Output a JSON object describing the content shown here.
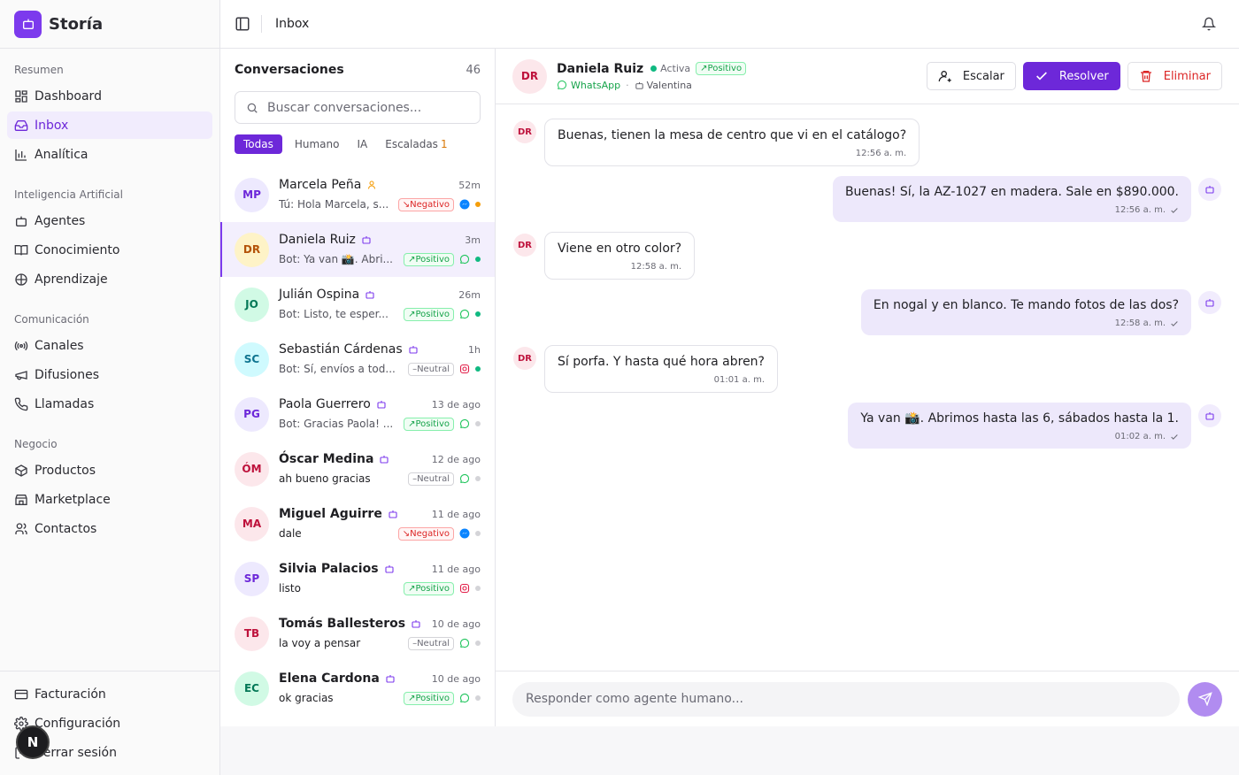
{
  "brand": {
    "name": "Storía"
  },
  "topbar": {
    "title": "Inbox"
  },
  "sidebar": {
    "sections": [
      {
        "title": "Resumen",
        "items": [
          {
            "label": "Dashboard",
            "icon": "home-icon",
            "active": false
          },
          {
            "label": "Inbox",
            "icon": "inbox-icon",
            "active": true
          },
          {
            "label": "Analítica",
            "icon": "chart-icon",
            "active": false
          }
        ]
      },
      {
        "title": "Inteligencia Artificial",
        "items": [
          {
            "label": "Agentes",
            "icon": "bot-icon",
            "active": false
          },
          {
            "label": "Conocimiento",
            "icon": "book-icon",
            "active": false
          },
          {
            "label": "Aprendizaje",
            "icon": "brain-icon",
            "active": false
          }
        ]
      },
      {
        "title": "Comunicación",
        "items": [
          {
            "label": "Canales",
            "icon": "radio-icon",
            "active": false
          },
          {
            "label": "Difusiones",
            "icon": "megaphone-icon",
            "active": false
          },
          {
            "label": "Llamadas",
            "icon": "phone-icon",
            "active": false
          }
        ]
      },
      {
        "title": "Negocio",
        "items": [
          {
            "label": "Productos",
            "icon": "package-icon",
            "active": false
          },
          {
            "label": "Marketplace",
            "icon": "store-icon",
            "active": false
          },
          {
            "label": "Contactos",
            "icon": "users-icon",
            "active": false
          }
        ]
      }
    ],
    "bottom": [
      {
        "label": "Facturación",
        "icon": "card-icon"
      },
      {
        "label": "Configuración",
        "icon": "gear-icon"
      },
      {
        "label": "Cerrar sesión",
        "icon": "logout-icon"
      }
    ],
    "floating_badge": "N"
  },
  "conversations": {
    "title": "Conversaciones",
    "count": "46",
    "search_placeholder": "Buscar conversaciones...",
    "filters": [
      {
        "label": "Todas",
        "active": true,
        "count": ""
      },
      {
        "label": "Humano",
        "active": false,
        "count": ""
      },
      {
        "label": "IA",
        "active": false,
        "count": ""
      },
      {
        "label": "Escaladas",
        "active": false,
        "count": "1"
      }
    ],
    "items": [
      {
        "initials": "MP",
        "name": "Marcela Peña",
        "handler": "human",
        "time": "52m",
        "preview": "Tú: Hola Marcela, s...",
        "sentiment": "Negativo",
        "channel": "messenger",
        "dot": "#f59e0b",
        "avatar_bg": "#ede9fe",
        "avatar_fg": "#6d28d9",
        "bold": false,
        "active": false,
        "dark_preview": false
      },
      {
        "initials": "DR",
        "name": "Daniela Ruiz",
        "handler": "bot",
        "time": "3m",
        "preview": "Bot: Ya van 📸. Abri...",
        "sentiment": "Positivo",
        "channel": "whatsapp",
        "dot": "#10b981",
        "avatar_bg": "#fef3c7",
        "avatar_fg": "#b45309",
        "bold": false,
        "active": true,
        "dark_preview": false
      },
      {
        "initials": "JO",
        "name": "Julián Ospina",
        "handler": "bot",
        "time": "26m",
        "preview": "Bot: Listo, te esper...",
        "sentiment": "Positivo",
        "channel": "whatsapp",
        "dot": "#10b981",
        "avatar_bg": "#d1fae5",
        "avatar_fg": "#047857",
        "bold": false,
        "active": false,
        "dark_preview": false
      },
      {
        "initials": "SC",
        "name": "Sebastián Cárdenas",
        "handler": "bot",
        "time": "1h",
        "preview": "Bot: Sí, envíos a tod...",
        "sentiment": "Neutral",
        "channel": "instagram",
        "dot": "#10b981",
        "avatar_bg": "#cffafe",
        "avatar_fg": "#0e7490",
        "bold": false,
        "active": false,
        "dark_preview": false
      },
      {
        "initials": "PG",
        "name": "Paola Guerrero",
        "handler": "bot",
        "time": "13 de ago",
        "preview": "Bot: Gracias Paola! ...",
        "sentiment": "Positivo",
        "channel": "whatsapp",
        "dot": "#d4d4d8",
        "avatar_bg": "#ede9fe",
        "avatar_fg": "#6d28d9",
        "bold": false,
        "active": false,
        "dark_preview": false
      },
      {
        "initials": "ÓM",
        "name": "Óscar Medina",
        "handler": "bot",
        "time": "12 de ago",
        "preview": "ah bueno gracias",
        "sentiment": "Neutral",
        "channel": "whatsapp",
        "dot": "#d4d4d8",
        "avatar_bg": "#fce7eb",
        "avatar_fg": "#be123c",
        "bold": true,
        "active": false,
        "dark_preview": true
      },
      {
        "initials": "MA",
        "name": "Miguel Aguirre",
        "handler": "bot",
        "time": "11 de ago",
        "preview": "dale",
        "sentiment": "Negativo",
        "channel": "messenger",
        "dot": "#d4d4d8",
        "avatar_bg": "#fce7eb",
        "avatar_fg": "#be123c",
        "bold": true,
        "active": false,
        "dark_preview": true
      },
      {
        "initials": "SP",
        "name": "Silvia Palacios",
        "handler": "bot",
        "time": "11 de ago",
        "preview": "listo",
        "sentiment": "Positivo",
        "channel": "instagram",
        "dot": "#d4d4d8",
        "avatar_bg": "#ede9fe",
        "avatar_fg": "#6d28d9",
        "bold": true,
        "active": false,
        "dark_preview": true
      },
      {
        "initials": "TB",
        "name": "Tomás Ballesteros",
        "handler": "bot",
        "time": "10 de ago",
        "preview": "la voy a pensar",
        "sentiment": "Neutral",
        "channel": "whatsapp",
        "dot": "#d4d4d8",
        "avatar_bg": "#fce7eb",
        "avatar_fg": "#be123c",
        "bold": true,
        "active": false,
        "dark_preview": true
      },
      {
        "initials": "EC",
        "name": "Elena Cardona",
        "handler": "bot",
        "time": "10 de ago",
        "preview": "ok gracias",
        "sentiment": "Positivo",
        "channel": "whatsapp",
        "dot": "#d4d4d8",
        "avatar_bg": "#d1fae5",
        "avatar_fg": "#047857",
        "bold": true,
        "active": false,
        "dark_preview": true
      }
    ]
  },
  "chat": {
    "contact": {
      "initials": "DR",
      "name": "Daniela Ruiz",
      "status": "Activa",
      "sentiment": "Positivo",
      "channel": "WhatsApp",
      "separator": "·",
      "agent": "Valentina"
    },
    "actions": {
      "escalate": "Escalar",
      "resolve": "Resolver",
      "delete": "Eliminar"
    },
    "messages": [
      {
        "direction": "in",
        "initials": "DR",
        "text": "Buenas, tienen la mesa de centro que vi en el catálogo?",
        "time": "12:56 a. m."
      },
      {
        "direction": "out",
        "text": "Buenas! Sí, la AZ-1027 en madera. Sale en $890.000.",
        "time": "12:56 a. m."
      },
      {
        "direction": "in",
        "initials": "DR",
        "text": "Viene en otro color?",
        "time": "12:58 a. m."
      },
      {
        "direction": "out",
        "text": "En nogal y en blanco. Te mando fotos de las dos?",
        "time": "12:58 a. m."
      },
      {
        "direction": "in",
        "initials": "DR",
        "text": "Sí porfa. Y hasta qué hora abren?",
        "time": "01:01 a. m."
      },
      {
        "direction": "out",
        "text": "Ya van 📸. Abrimos hasta las 6, sábados hasta la 1.",
        "time": "01:02 a. m."
      }
    ],
    "composer_placeholder": "Responder como agente humano..."
  },
  "colors": {
    "accent": "#6d28d9",
    "positive": "#16a34a",
    "negative": "#dc2626",
    "whatsapp": "#22c55e",
    "messenger": "#0a84ff",
    "instagram": "#e11d48"
  }
}
